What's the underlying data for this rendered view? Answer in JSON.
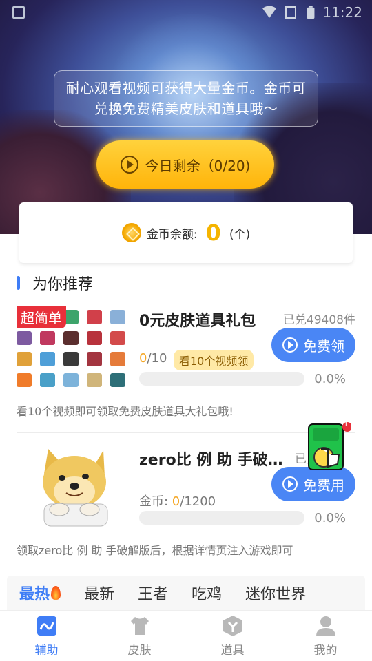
{
  "status_bar": {
    "time": "11:22"
  },
  "hero": {
    "notice": "耐心观看视频可获得大量金币。金币可兑换免费精美皮肤和道具哦～",
    "today_button": "今日剩余（0/20)"
  },
  "coins": {
    "label": "金币余额:",
    "value": "0",
    "unit": "(个)"
  },
  "section": {
    "title": "为你推荐"
  },
  "items": [
    {
      "badge": "超简单",
      "title": "0元皮肤道具礼包",
      "sold": "已兑49408件",
      "progress_current": "0",
      "progress_total": "/10",
      "watch_tag": "看10个视频领",
      "button": "免费领",
      "percent": "0.0%",
      "progress": 0.0,
      "description": "看10个视频即可领取免费皮肤道具大礼包哦!"
    },
    {
      "title": "zero比 例 助 手破...",
      "sold": "已兑",
      "coin_label": "金币: ",
      "progress_current": "0",
      "progress_total": "/1200",
      "button": "免费用",
      "percent": "0.0%",
      "progress": 0.0,
      "description": "领取zero比 例 助 手破解版后，根据详情页注入游戏即可"
    }
  ],
  "float_badge": {
    "count": "1"
  },
  "categories": [
    "最热",
    "最新",
    "王者",
    "吃鸡",
    "迷你世界"
  ],
  "nav": [
    {
      "label": "辅助",
      "icon": "assist-icon",
      "active": true
    },
    {
      "label": "皮肤",
      "icon": "tshirt-icon",
      "active": false
    },
    {
      "label": "道具",
      "icon": "box-icon",
      "active": false
    },
    {
      "label": "我的",
      "icon": "profile-icon",
      "active": false
    }
  ],
  "colors": {
    "accent": "#3f7df6",
    "gold": "#f5b400",
    "badge_red": "#e8303a"
  }
}
